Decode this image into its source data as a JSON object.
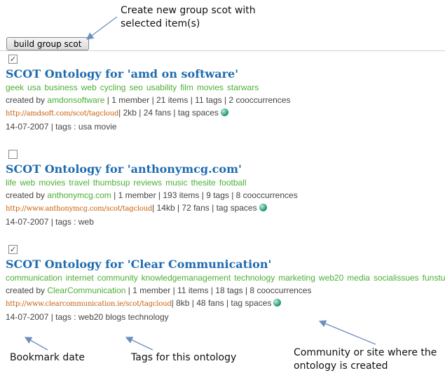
{
  "annotations": {
    "top": "Create new group scot with selected item(s)",
    "bookmark_date": "Bookmark date",
    "tags_for_ontology": "Tags for this ontology",
    "community": "Community or site where the ontology is created"
  },
  "toolbar": {
    "build_label": "build group scot"
  },
  "entries": [
    {
      "checked": true,
      "title": "SCOT Ontology for 'amd on software'",
      "tags": [
        "geek",
        "usa",
        "business",
        "web",
        "cycling",
        "seo",
        "usability",
        "film",
        "movies",
        "starwars"
      ],
      "created_by_label": "created by",
      "creator": "amdonsoftware",
      "stats": "| 1 member | 21 items | 11 tags | 2 cooccurrences",
      "url": "http://amdsoft.com/scot/tagcloud",
      "url_stats": "| 2kb | 24 fans | tag spaces",
      "date_line": "14-07-2007 | tags : usa movie"
    },
    {
      "checked": false,
      "title": "SCOT Ontology for 'anthonymcg.com'",
      "tags": [
        "life",
        "web",
        "movies",
        "travel",
        "thumbsup",
        "reviews",
        "music",
        "thesite",
        "football"
      ],
      "created_by_label": "created by",
      "creator": "anthonymcg.com",
      "stats": "| 1 member | 193 items | 9 tags | 8 cooccurrences",
      "url": "http://www.anthonymcg.com/scot/tagcloud",
      "url_stats": "| 14kb | 72 fans | tag spaces",
      "date_line": "14-07-2007 | tags : web"
    },
    {
      "checked": true,
      "title": "SCOT Ontology for 'Clear Communication'",
      "tags": [
        "communication",
        "internet",
        "community",
        "knowledgemanagement",
        "technology",
        "marketing",
        "web20",
        "media",
        "socialissues",
        "funstuff"
      ],
      "created_by_label": "created by",
      "creator": "ClearCommunication",
      "stats": "| 1 member | 11 items | 18 tags | 8 cooccurrences",
      "url": "http://www.clearcommunication.ie/scot/tagcloud",
      "url_stats": "| 8kb | 48 fans | tag spaces",
      "date_line": "14-07-2007 | tags : web20 blogs technology"
    }
  ]
}
